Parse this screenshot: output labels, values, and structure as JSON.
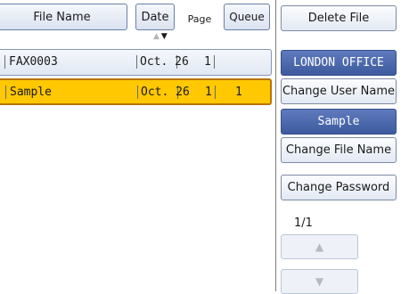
{
  "columns": {
    "file_name": "File Name",
    "date": "Date",
    "page": "Page",
    "queue": "Queue"
  },
  "sort_arrows": {
    "up": "▲",
    "down": "▼"
  },
  "rows": [
    {
      "name": "FAX0003",
      "date": "Oct. 26",
      "page": "1",
      "queue": "",
      "selected": false
    },
    {
      "name": "Sample",
      "date": "Oct. 26",
      "page": "1",
      "queue": "1",
      "selected": true
    }
  ],
  "actions": {
    "delete_file": "Delete File",
    "user_name_value": "LONDON OFFICE",
    "change_user_name": "Change User Name",
    "file_name_value": "Sample",
    "change_file_name": "Change File Name",
    "change_password": "Change Password"
  },
  "pagination": {
    "counter": "1/1",
    "up_icon": "▲",
    "down_icon": "▼"
  },
  "colors": {
    "selected_row": "#ffc800",
    "field_blue": "#4a67a9"
  }
}
